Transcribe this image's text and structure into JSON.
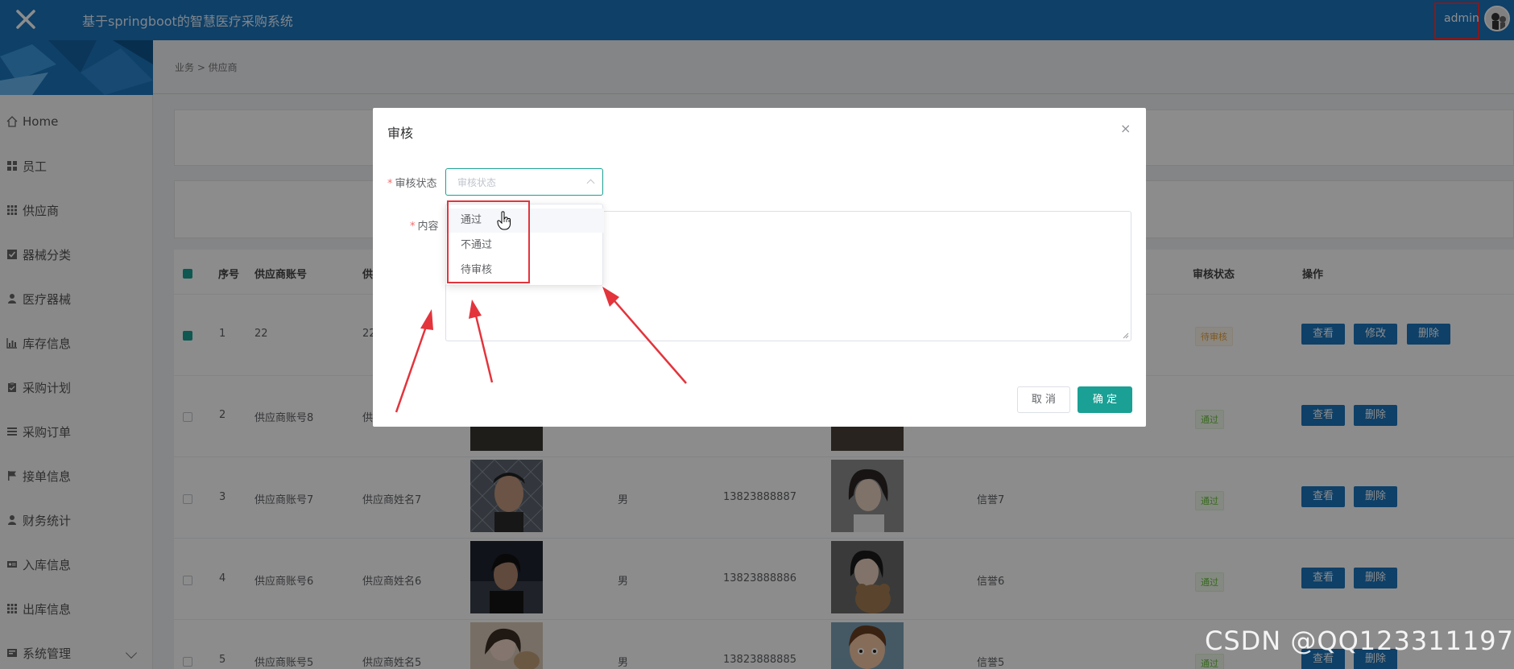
{
  "app": {
    "title": "基于springboot的智慧医疗采购系统",
    "user": "admin",
    "close_icon": "close-icon",
    "accent": "#1a75bd",
    "teal": "#1aa094"
  },
  "breadcrumb": {
    "text": "业务 > 供应商"
  },
  "sidebar": {
    "items": [
      {
        "label": "Home",
        "icon": "home-icon"
      },
      {
        "label": "员工",
        "icon": "grid-icon"
      },
      {
        "label": "供应商",
        "icon": "grid-icon"
      },
      {
        "label": "器械分类",
        "icon": "check-square-icon"
      },
      {
        "label": "医疗器械",
        "icon": "user-icon"
      },
      {
        "label": "库存信息",
        "icon": "chart-icon"
      },
      {
        "label": "采购计划",
        "icon": "clipboard-icon"
      },
      {
        "label": "采购订单",
        "icon": "list-icon"
      },
      {
        "label": "接单信息",
        "icon": "flag-icon"
      },
      {
        "label": "财务统计",
        "icon": "user-icon"
      },
      {
        "label": "入库信息",
        "icon": "id-card-icon"
      },
      {
        "label": "出库信息",
        "icon": "grid-icon"
      },
      {
        "label": "系统管理",
        "icon": "gear-icon"
      }
    ]
  },
  "table": {
    "headers": {
      "index": "序号",
      "account": "供应商账号",
      "name_trunc": "供",
      "status": "审核状态",
      "ops": "操作"
    },
    "rows": [
      {
        "index": "1",
        "account": "22",
        "name": "22",
        "gender": "",
        "phone": "",
        "credit": "",
        "status": "待审核",
        "status_type": "pend",
        "buttons": [
          "查看",
          "修改",
          "删除"
        ]
      },
      {
        "index": "2",
        "account": "供应商账号8",
        "name": "供",
        "gender": "",
        "phone": "",
        "credit": "",
        "status": "通过",
        "status_type": "pass",
        "buttons": [
          "查看",
          "删除"
        ]
      },
      {
        "index": "3",
        "account": "供应商账号7",
        "name": "供应商姓名7",
        "gender": "男",
        "phone": "13823888887",
        "credit": "信誉7",
        "status": "通过",
        "status_type": "pass",
        "buttons": [
          "查看",
          "删除"
        ]
      },
      {
        "index": "4",
        "account": "供应商账号6",
        "name": "供应商姓名6",
        "gender": "男",
        "phone": "13823888886",
        "credit": "信誉6",
        "status": "通过",
        "status_type": "pass",
        "buttons": [
          "查看",
          "删除"
        ]
      },
      {
        "index": "5",
        "account": "供应商账号5",
        "name": "供应商姓名5",
        "gender": "男",
        "phone": "13823888885",
        "credit": "信誉5",
        "status": "通过",
        "status_type": "pass",
        "buttons": [
          "查看",
          "删除"
        ]
      }
    ]
  },
  "dialog": {
    "title": "审核",
    "close": "×",
    "status_label": "审核状态",
    "content_label": "内容",
    "select_placeholder": "审核状态",
    "options": [
      "通过",
      "不通过",
      "待审核"
    ],
    "cancel": "取 消",
    "confirm": "确 定"
  },
  "watermark": "CSDN @QQ123311197"
}
